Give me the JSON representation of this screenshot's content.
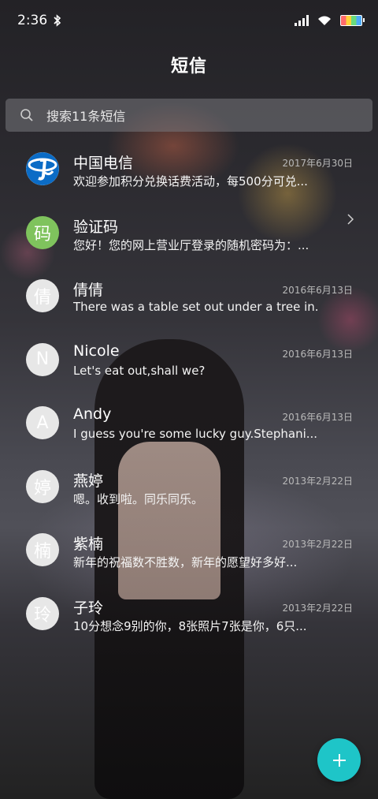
{
  "status_bar": {
    "time": "2:36",
    "icons": [
      "bluetooth-icon",
      "signal-icon",
      "wifi-icon",
      "battery-icon"
    ]
  },
  "header": {
    "title": "短信"
  },
  "search": {
    "placeholder": "搜索11条短信",
    "icon": "search-icon"
  },
  "conversations": [
    {
      "name": "中国电信",
      "date": "2017年6月30日",
      "preview": "欢迎参加积分兑换话费活动，每500分可兑...",
      "avatar": "logo",
      "avatar_text": ""
    },
    {
      "name": "验证码",
      "date": "",
      "preview": "您好！您的网上营业厅登录的随机密码为：...",
      "avatar": "green",
      "avatar_text": "码"
    },
    {
      "name": "倩倩",
      "date": "2016年6月13日",
      "preview": "There was a table set out under a tree in...",
      "avatar": "gray",
      "avatar_text": "倩"
    },
    {
      "name": "Nicole",
      "date": "2016年6月13日",
      "preview": "Let's eat out,shall we?",
      "avatar": "gray",
      "avatar_text": "N"
    },
    {
      "name": "Andy",
      "date": "2016年6月13日",
      "preview": "I guess you're some lucky guy.Stephani...",
      "avatar": "gray",
      "avatar_text": "A"
    },
    {
      "name": "燕婷",
      "date": "2013年2月22日",
      "preview": "嗯。收到啦。同乐同乐。",
      "avatar": "gray",
      "avatar_text": "婷"
    },
    {
      "name": "紫楠",
      "date": "2013年2月22日",
      "preview": "新年的祝福数不胜数，新年的愿望好多好...",
      "avatar": "gray",
      "avatar_text": "楠"
    },
    {
      "name": "子玲",
      "date": "2013年2月22日",
      "preview": "10分想念9别的你，8张照片7张是你，6只...",
      "avatar": "gray",
      "avatar_text": "玲"
    }
  ],
  "fab": {
    "icon": "plus-icon"
  },
  "colors": {
    "accent": "#1ec5c8",
    "avatar_green": "#7fc35d",
    "avatar_gray": "#e7e7e7"
  }
}
